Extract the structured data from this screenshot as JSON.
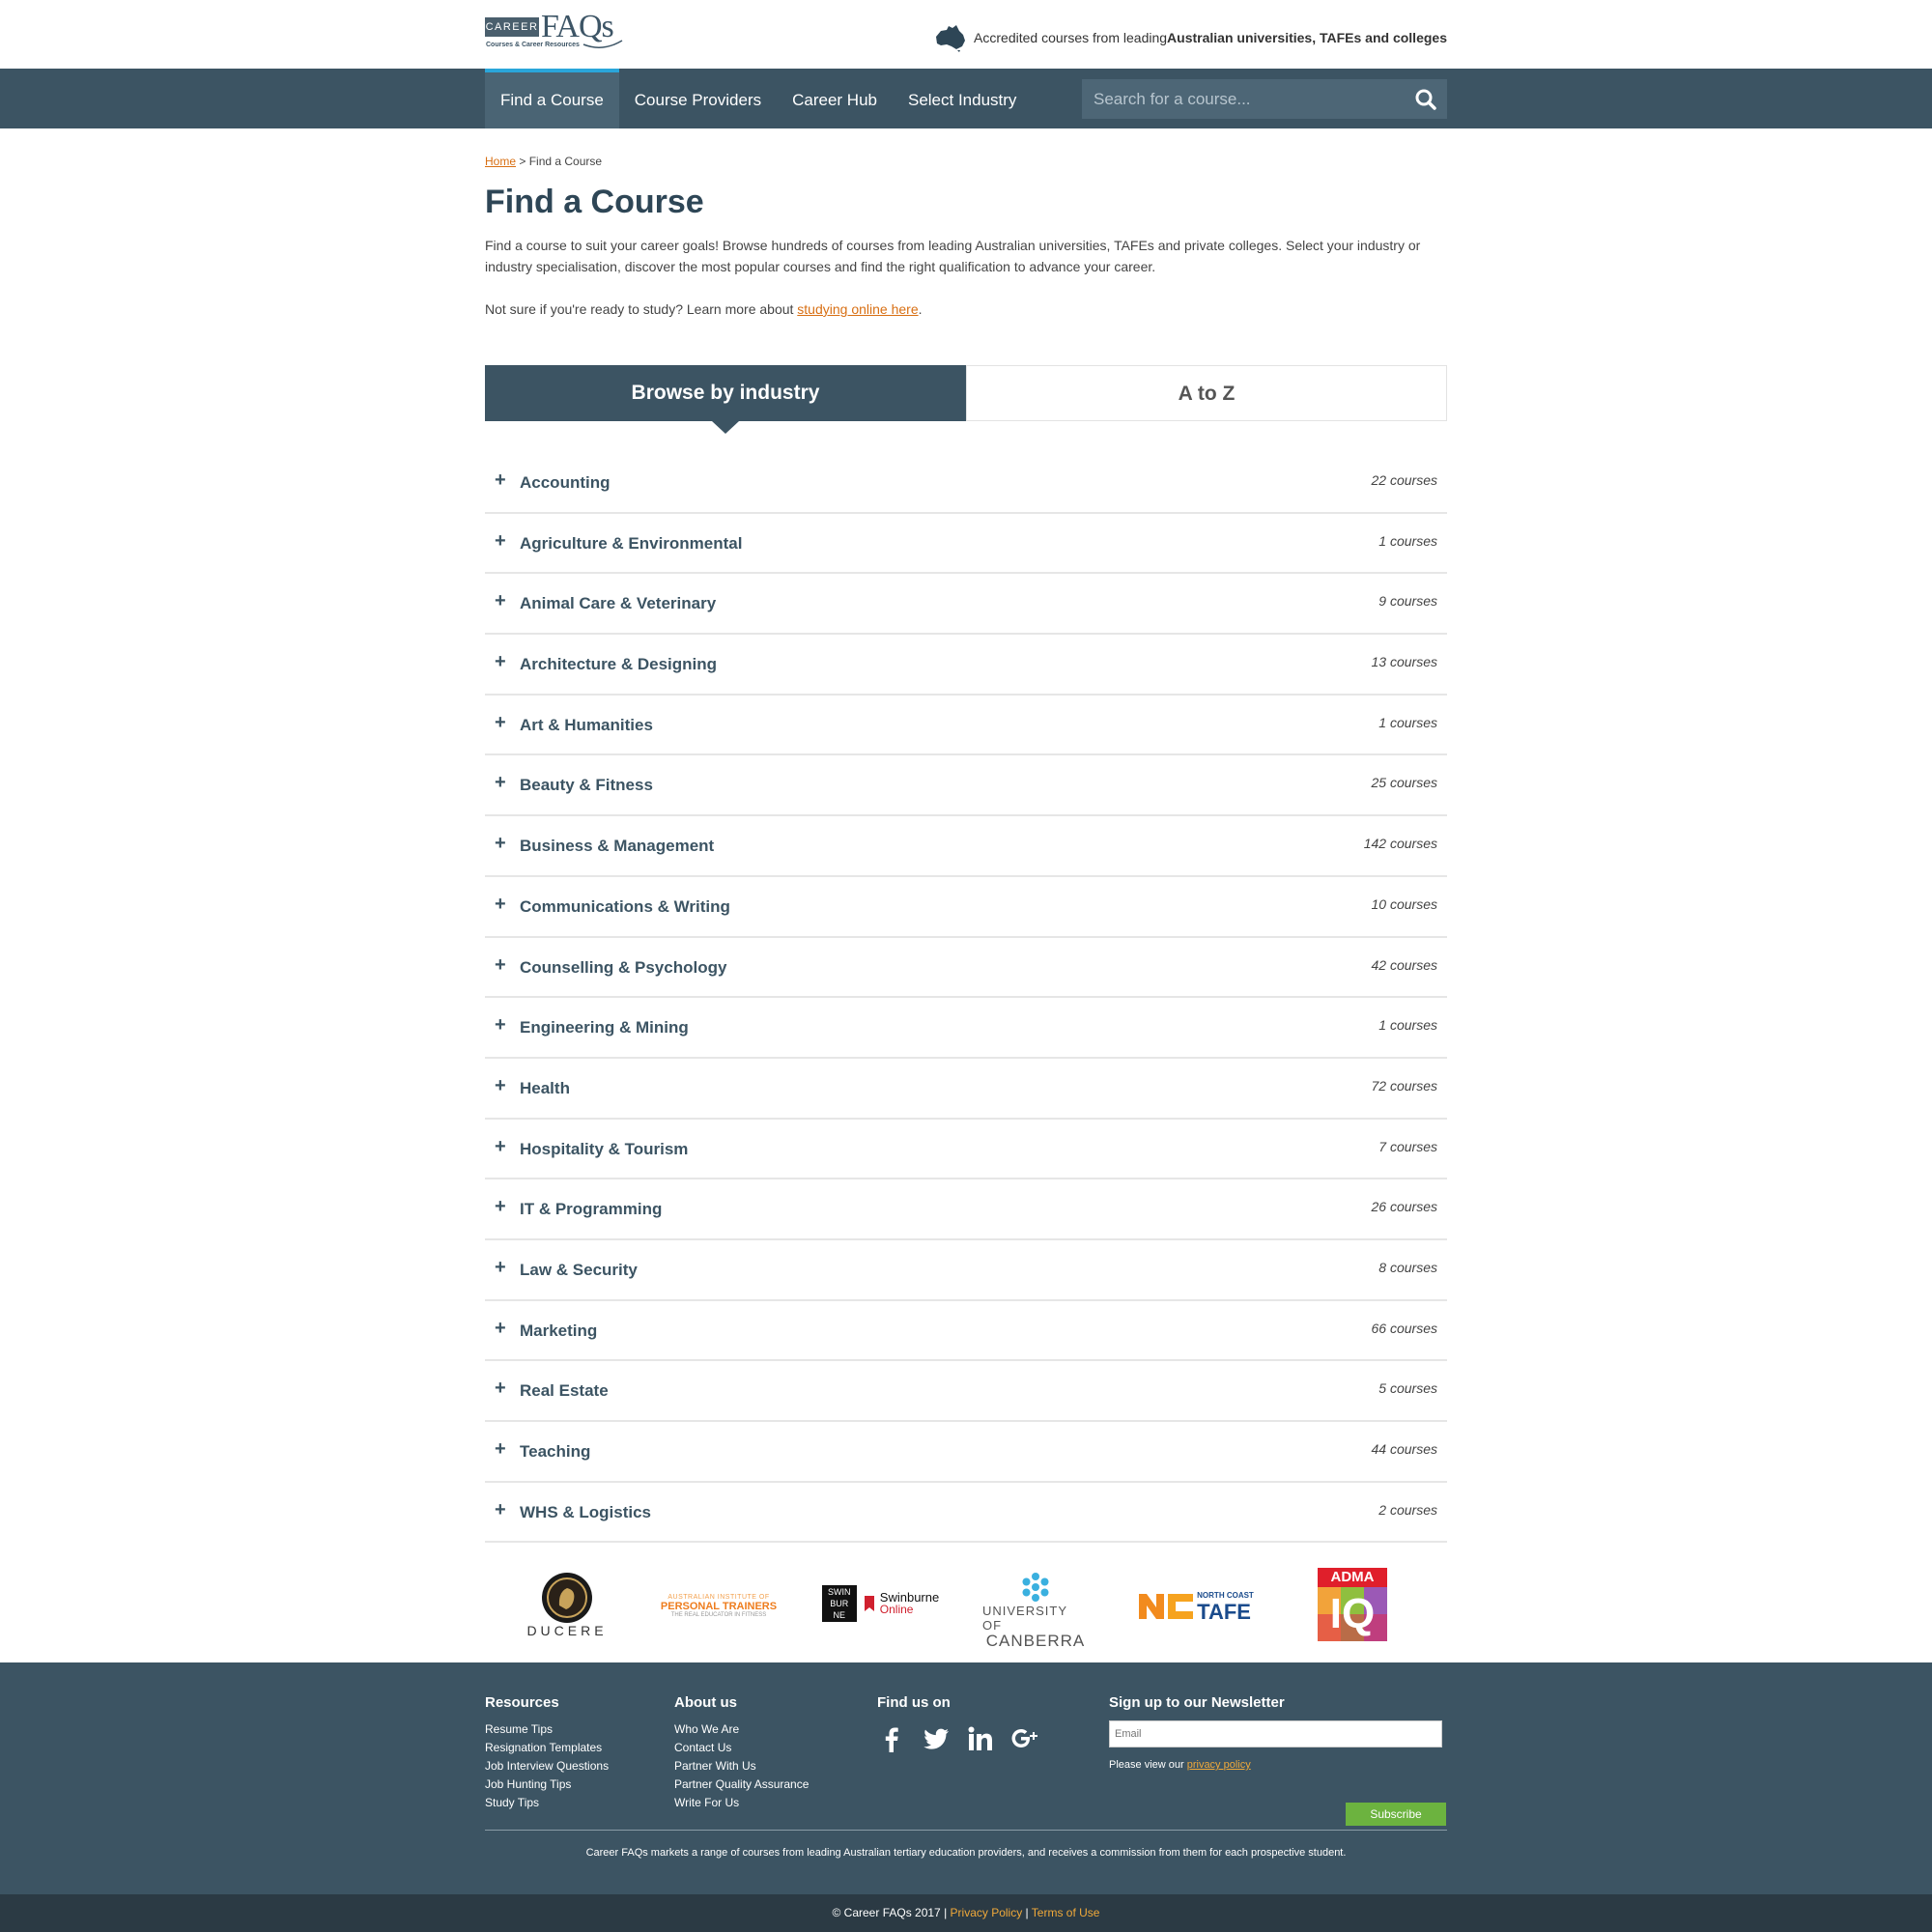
{
  "header": {
    "logo_career": "CAREER",
    "logo_faqs": "FAQs",
    "logo_tagline": "Courses & Career Resources",
    "accredited_prefix": "Accredited courses from leading ",
    "accredited_bold": "Australian universities, TAFEs and colleges"
  },
  "nav": {
    "items": [
      {
        "label": "Find a Course",
        "active": true
      },
      {
        "label": "Course Providers",
        "active": false
      },
      {
        "label": "Career Hub",
        "active": false
      },
      {
        "label": "Select Industry",
        "active": false
      }
    ],
    "search_placeholder": "Search for a course..."
  },
  "breadcrumb": {
    "home": "Home",
    "separator": " > ",
    "current": "Find a Course"
  },
  "page": {
    "title": "Find a Course",
    "intro": "Find a course to suit your career goals! Browse hundreds of courses from leading Australian universities, TAFEs and private colleges. Select your industry or industry specialisation, discover the most popular courses and find the right qualification to advance your career.",
    "intro2_prefix": "Not sure if you're ready to study? Learn more about ",
    "intro2_link": "studying online here",
    "intro2_suffix": "."
  },
  "tabs": {
    "browse": "Browse by industry",
    "atoz": "A to Z"
  },
  "industries": [
    {
      "name": "Accounting",
      "count": "22 courses"
    },
    {
      "name": "Agriculture & Environmental",
      "count": "1 courses"
    },
    {
      "name": "Animal Care & Veterinary",
      "count": "9 courses"
    },
    {
      "name": "Architecture & Designing",
      "count": "13 courses"
    },
    {
      "name": "Art & Humanities",
      "count": "1 courses"
    },
    {
      "name": "Beauty & Fitness",
      "count": "25 courses"
    },
    {
      "name": "Business & Management",
      "count": "142 courses"
    },
    {
      "name": "Communications & Writing",
      "count": "10 courses"
    },
    {
      "name": "Counselling & Psychology",
      "count": "42 courses"
    },
    {
      "name": "Engineering & Mining",
      "count": "1 courses"
    },
    {
      "name": "Health",
      "count": "72 courses"
    },
    {
      "name": "Hospitality & Tourism",
      "count": "7 courses"
    },
    {
      "name": "IT & Programming",
      "count": "26 courses"
    },
    {
      "name": "Law & Security",
      "count": "8 courses"
    },
    {
      "name": "Marketing",
      "count": "66 courses"
    },
    {
      "name": "Real Estate",
      "count": "5 courses"
    },
    {
      "name": "Teaching",
      "count": "44 courses"
    },
    {
      "name": "WHS & Logistics",
      "count": "2 courses"
    }
  ],
  "partners": {
    "ducere": "DUCERE",
    "aipt_line1": "AUSTRALIAN INSTITUTE OF",
    "aipt_line2": "PERSONAL TRAINERS",
    "aipt_line3": "THE REAL EDUCATOR IN FITNESS",
    "swin_box1": "SWIN",
    "swin_box2": "BUR",
    "swin_box3": "NE",
    "swin_name": "Swinburne",
    "swin_online": "Online",
    "uc_line1": "UNIVERSITY OF",
    "uc_line2": "CANBERRA",
    "nc_small": "NORTH COAST",
    "nc_tafe": "TAFE",
    "adma": "ADMA",
    "adma_iq": "IQ"
  },
  "footer": {
    "resources_title": "Resources",
    "resources": [
      "Resume Tips",
      "Resignation Templates",
      "Job Interview Questions",
      "Job Hunting Tips",
      "Study Tips"
    ],
    "about_title": "About us",
    "about": [
      "Who We Are",
      "Contact Us",
      "Partner With Us",
      "Partner Quality Assurance",
      "Write For Us"
    ],
    "find_title": "Find us on",
    "newsletter_title": "Sign up to our Newsletter",
    "email_placeholder": "Email",
    "privacy_prefix": "Please view our ",
    "privacy_link": "privacy policy",
    "subscribe": "Subscribe",
    "disclaimer": "Career FAQs markets a range of courses from leading Australian tertiary education providers, and receives a commission from them for each prospective student.",
    "copyright": "© Career FAQs 2017",
    "sep": " | ",
    "privacy_policy": "Privacy Policy",
    "terms": "Terms of Use"
  },
  "colors": {
    "nav_bg": "#3c5463",
    "accent_orange": "#d86f13",
    "subscribe_green": "#6cb33f",
    "active_tab_border": "#2aa6da"
  }
}
